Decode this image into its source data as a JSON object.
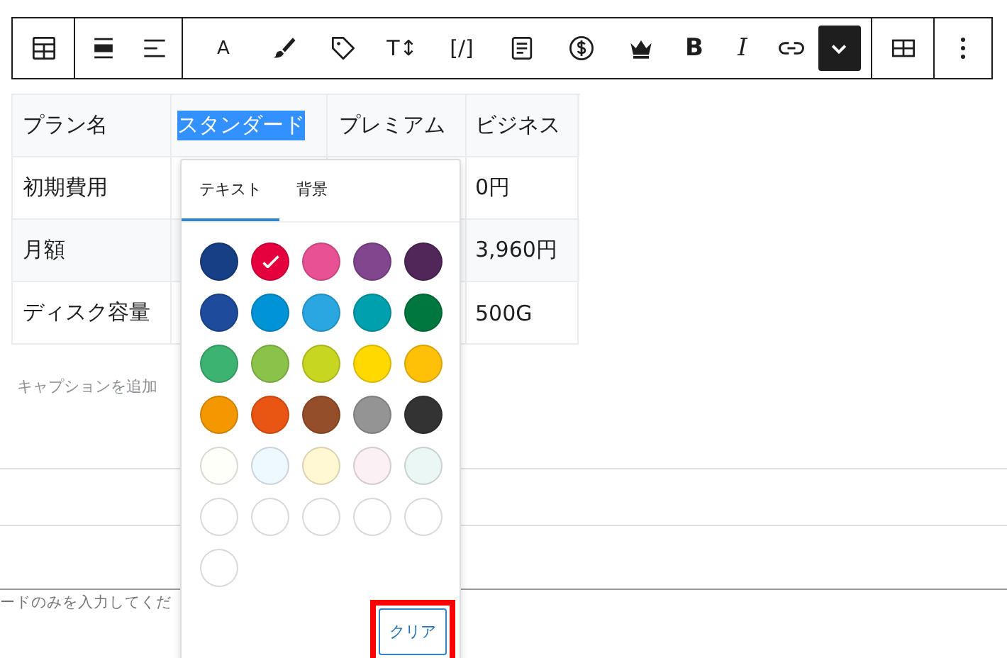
{
  "toolbar": {
    "groups": [
      {
        "items": [
          {
            "kind": "icon",
            "pressed": false
          }
        ]
      },
      {
        "items": [
          {
            "kind": "icon",
            "pressed": false
          },
          {
            "kind": "icon",
            "pressed": false
          }
        ]
      },
      {
        "items": [
          {
            "kind": "text",
            "label": "A",
            "pressed": false
          },
          {
            "kind": "icon",
            "pressed": false
          },
          {
            "kind": "icon",
            "pressed": false
          },
          {
            "kind": "text",
            "label": "T↕",
            "pressed": false
          },
          {
            "kind": "text",
            "label": "[/]",
            "pressed": false
          },
          {
            "kind": "icon",
            "pressed": false
          },
          {
            "kind": "icon",
            "pressed": false
          },
          {
            "kind": "icon",
            "pressed": false
          },
          {
            "kind": "text",
            "label": "B",
            "pressed": false
          },
          {
            "kind": "text",
            "label": "I",
            "pressed": false
          },
          {
            "kind": "icon",
            "pressed": false
          },
          {
            "kind": "icon",
            "pressed": true
          }
        ]
      },
      {
        "items": [
          {
            "kind": "icon",
            "pressed": false
          }
        ]
      },
      {
        "items": [
          {
            "kind": "icon",
            "pressed": false
          }
        ]
      }
    ]
  },
  "table": {
    "header": [
      {
        "text": "プラン名",
        "highlighted": false
      },
      {
        "text": "スタンダード",
        "highlighted": true
      },
      {
        "text": "プレミアム",
        "highlighted": false
      },
      {
        "text": "ビジネス",
        "highlighted": false
      }
    ],
    "rows": [
      {
        "label": "初期費用",
        "value": "0円"
      },
      {
        "label": "月額",
        "value": "3,960円"
      },
      {
        "label": "ディスク容量",
        "value": "500G"
      }
    ],
    "caption_placeholder": "キャプションを追加"
  },
  "field": {
    "placeholder": "ードのみを入力してくだ"
  },
  "color_popover": {
    "tabs": [
      {
        "label": "テキスト",
        "selected": true
      },
      {
        "label": "背景",
        "selected": false
      }
    ],
    "swatches": [
      {
        "color": "#173f85",
        "selected": false
      },
      {
        "color": "#e5003e",
        "selected": true
      },
      {
        "color": "#e85295",
        "selected": false
      },
      {
        "color": "#82468f",
        "selected": false
      },
      {
        "color": "#51275a",
        "selected": false
      },
      {
        "color": "#1e4b9b",
        "selected": false
      },
      {
        "color": "#0093d6",
        "selected": false
      },
      {
        "color": "#2aa7e1",
        "selected": false
      },
      {
        "color": "#00a0af",
        "selected": false
      },
      {
        "color": "#00773e",
        "selected": false
      },
      {
        "color": "#3cb371",
        "selected": false
      },
      {
        "color": "#8bc34a",
        "selected": false
      },
      {
        "color": "#c6d621",
        "selected": false
      },
      {
        "color": "#ffd900",
        "selected": false
      },
      {
        "color": "#ffc107",
        "selected": false
      },
      {
        "color": "#f39800",
        "selected": false
      },
      {
        "color": "#e95513",
        "selected": false
      },
      {
        "color": "#954e2a",
        "selected": false
      },
      {
        "color": "#949494",
        "selected": false
      },
      {
        "color": "#333333",
        "selected": false
      },
      {
        "color": "#fffffa",
        "selected": false
      },
      {
        "color": "#eef9ff",
        "selected": false
      },
      {
        "color": "#fff8d2",
        "selected": false
      },
      {
        "color": "#fbf0f3",
        "selected": false
      },
      {
        "color": "#ebf7f4",
        "selected": false
      },
      {
        "color": "#ffffff",
        "selected": false
      },
      {
        "color": "#ffffff",
        "selected": false
      },
      {
        "color": "#ffffff",
        "selected": false
      },
      {
        "color": "#ffffff",
        "selected": false
      },
      {
        "color": "#ffffff",
        "selected": false
      },
      {
        "color": "#ffffff",
        "selected": false
      }
    ],
    "clear_button": {
      "label": "クリア",
      "highlighted": true
    }
  }
}
